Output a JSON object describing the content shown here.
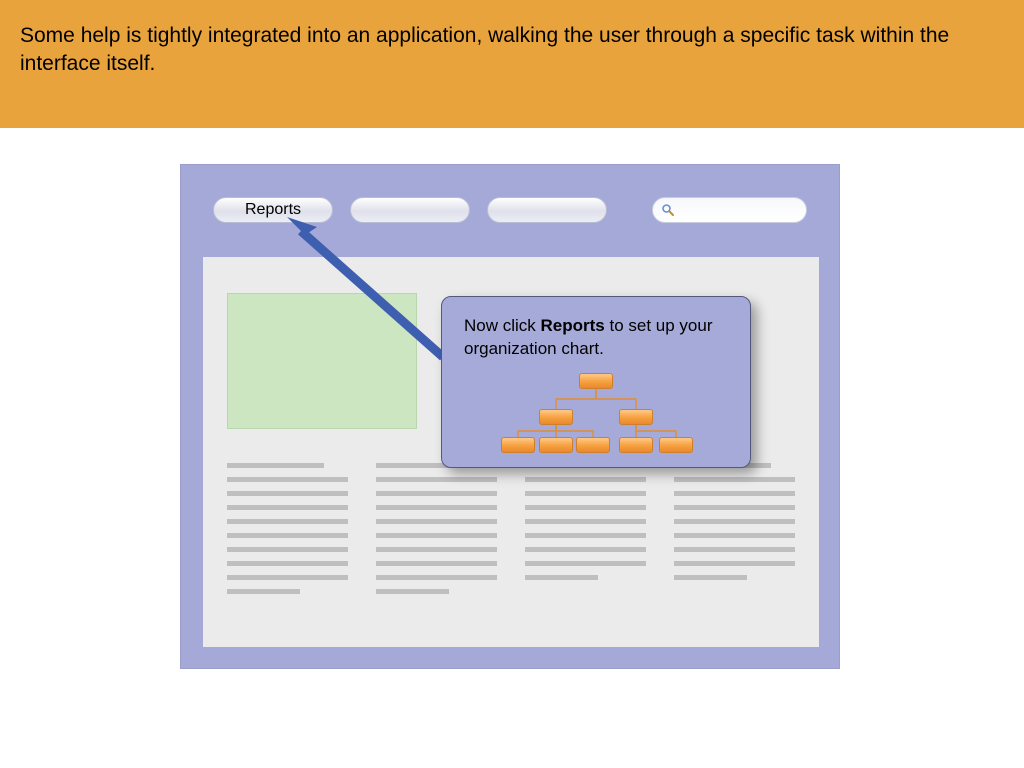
{
  "banner": {
    "text": "Some help is tightly integrated into an application, walking the user through a specific task within the interface itself."
  },
  "toolbar": {
    "tabs": [
      "Reports",
      "",
      ""
    ]
  },
  "callout": {
    "pre": "Now click ",
    "bold": "Reports",
    "post": " to set up your organization chart."
  },
  "icons": {
    "search": "search-icon"
  }
}
